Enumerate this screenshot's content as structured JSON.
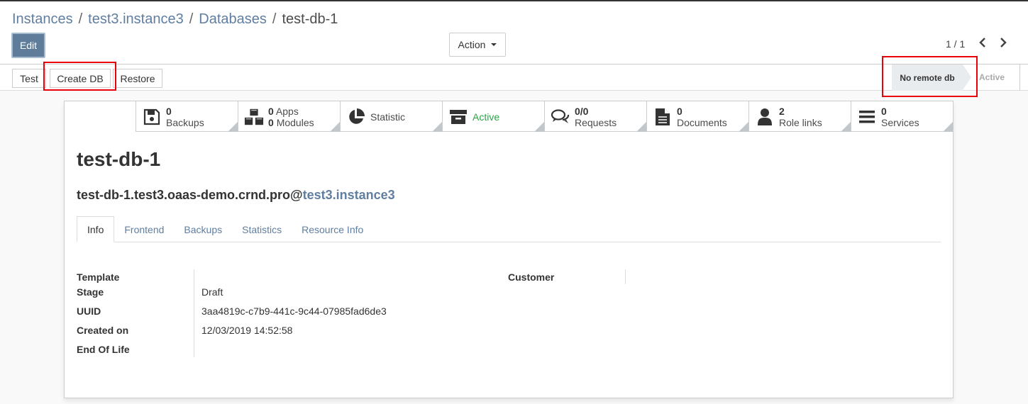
{
  "breadcrumb": {
    "items": [
      "Instances",
      "test3.instance3",
      "Databases"
    ],
    "separator": "/",
    "current": "test-db-1"
  },
  "toolbar": {
    "edit_label": "Edit",
    "action_label": "Action"
  },
  "pager": {
    "value": "1 / 1"
  },
  "statusbar": {
    "buttons": [
      "Test",
      "Create DB",
      "Restore"
    ],
    "stages": {
      "current": "No remote db",
      "next": "Active"
    }
  },
  "smart_buttons": [
    {
      "icon": "floppy-disk-icon",
      "value": "0",
      "label": "Backups"
    },
    {
      "icon": "cubes-icon",
      "value": "0",
      "label": "Apps",
      "value2": "0",
      "label2": "Modules"
    },
    {
      "icon": "pie-chart-icon",
      "label": "Statistic"
    },
    {
      "icon": "archive-icon",
      "label": "Active"
    },
    {
      "icon": "comments-icon",
      "value": "0/0",
      "label": "Requests"
    },
    {
      "icon": "document-icon",
      "value": "0",
      "label": "Documents"
    },
    {
      "icon": "user-icon",
      "value": "2",
      "label": "Role links"
    },
    {
      "icon": "list-icon",
      "value": "0",
      "label": "Services"
    }
  ],
  "record": {
    "title": "test-db-1",
    "subtitle_prefix": "test-db-1.test3.oaas-demo.crnd.pro@",
    "subtitle_link": "test3.instance3"
  },
  "tabs": [
    "Info",
    "Frontend",
    "Backups",
    "Statistics",
    "Resource Info"
  ],
  "fields": {
    "template": {
      "label": "Template",
      "value": ""
    },
    "stage": {
      "label": "Stage",
      "value": "Draft"
    },
    "uuid": {
      "label": "UUID",
      "value": "3aa4819c-c7b9-441c-9c44-07985fad6de3"
    },
    "created_on": {
      "label": "Created on",
      "value": "12/03/2019 14:52:58"
    },
    "end_of_life": {
      "label": "End Of Life",
      "value": ""
    },
    "customer": {
      "label": "Customer",
      "value": ""
    }
  },
  "colors": {
    "primary": "#5f7d9a",
    "link": "#5f7ea0",
    "active_green": "#28a745",
    "highlight_red": "#e8000b"
  }
}
